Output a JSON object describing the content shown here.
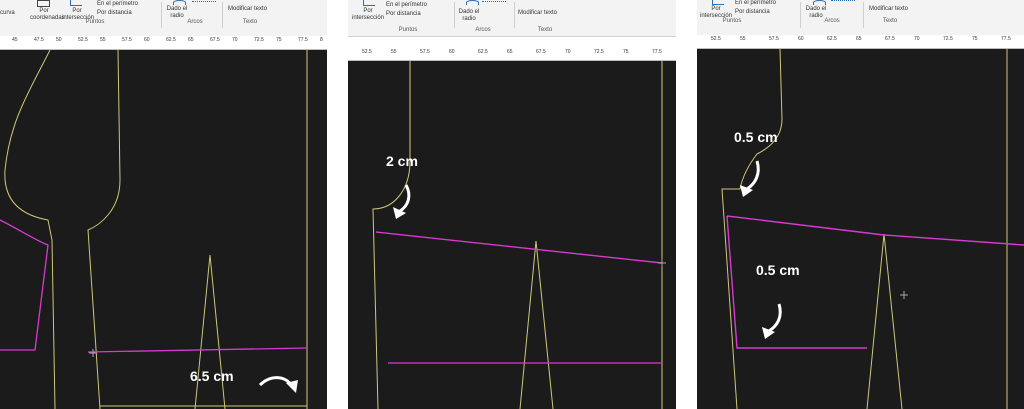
{
  "panel1": {
    "ribbon": {
      "left_label": "curva",
      "by_coordinates": "Por coordenadas",
      "by_intersection": "Por intersección",
      "on_perimeter": "En el perímetro",
      "by_distance": "Por distancia",
      "points_group": "Puntos",
      "given_radius": "Dado el radio",
      "arcs_group": "Arcos",
      "modify_text": "Modificar texto",
      "text_group": "Texto"
    },
    "ruler_ticks": [
      "45",
      "47.5",
      "50",
      "52.5",
      "55",
      "57.5",
      "60",
      "62.5",
      "65",
      "67.5",
      "70",
      "72.5",
      "75",
      "77.5",
      "8"
    ],
    "annotation": "6.5 cm"
  },
  "panel2": {
    "ribbon": {
      "by_intersection": "Por intersección",
      "on_perimeter": "En el perímetro",
      "by_distance": "Por distancia",
      "points_group": "Puntos",
      "given_radius": "Dado el radio",
      "arcs_group": "Arcos",
      "modify_text": "Modificar texto",
      "text_group": "Texto"
    },
    "ruler_ticks": [
      "52.5",
      "55",
      "57.5",
      "60",
      "62.5",
      "65",
      "67.5",
      "70",
      "72.5",
      "75",
      "77.5"
    ],
    "annotation": "2 cm"
  },
  "panel3": {
    "ribbon": {
      "by_intersection": "Por intersección",
      "on_perimeter": "En el perímetro",
      "by_distance": "Por distancia",
      "points_group": "Puntos",
      "given_radius": "Dado el radio",
      "arcs_group": "Arcos",
      "modify_text": "Modificar texto",
      "text_group": "Texto"
    },
    "ruler_ticks": [
      "52.5",
      "55",
      "57.5",
      "60",
      "62.5",
      "65",
      "67.5",
      "70",
      "72.5",
      "75",
      "77.5"
    ],
    "annotation_top": "0.5 cm",
    "annotation_bottom": "0.5 cm"
  },
  "colors": {
    "canvas": "#1b1b1b",
    "pattern_line": "#cfc77a",
    "magenta": "#d63ad0",
    "annotation_text": "#ffffff"
  }
}
